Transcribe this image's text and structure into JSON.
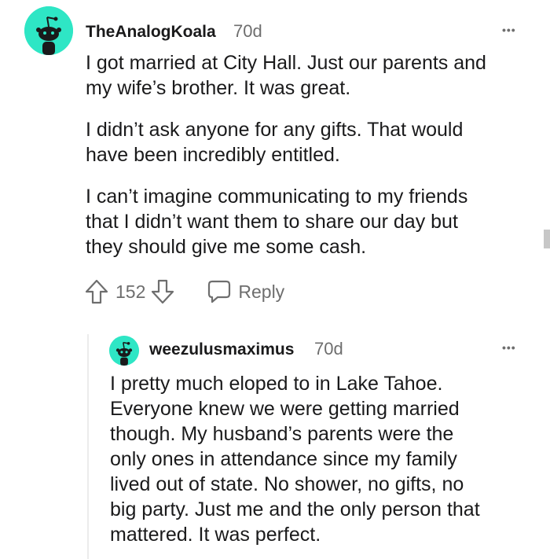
{
  "comments": [
    {
      "username": "TheAnalogKoala",
      "age": "70d",
      "more": "•••",
      "paragraphs": [
        [
          "I got married at City Hall. Just our parents and",
          "my wife’s brother. It was great."
        ],
        [
          "I didn’t ask anyone for any gifts. That would",
          "have been incredibly entitled."
        ],
        [
          "I can’t imagine communicating to my friends",
          "that I didn’t want them to share our day but",
          "they should give me some cash."
        ]
      ],
      "votes": "152",
      "reply_label": "Reply"
    },
    {
      "username": "weezulusmaximus",
      "age": "70d",
      "more": "•••",
      "lines": [
        "I pretty much eloped to in Lake Tahoe.",
        "Everyone knew we were getting married",
        "though. My husband’s parents were the",
        "only ones in attendance since my family",
        "lived out of state. No shower, no gifts, no",
        "big party. Just me and the only person that",
        "mattered. It was perfect."
      ]
    }
  ],
  "colors": {
    "avatar": "#2ee6c5",
    "text": "#1a1a1b",
    "meta": "#6e6e6e"
  },
  "icons": [
    "snoo-avatar-icon",
    "upvote-arrow-icon",
    "downvote-arrow-icon",
    "reply-bubble-icon",
    "more-options-icon"
  ]
}
